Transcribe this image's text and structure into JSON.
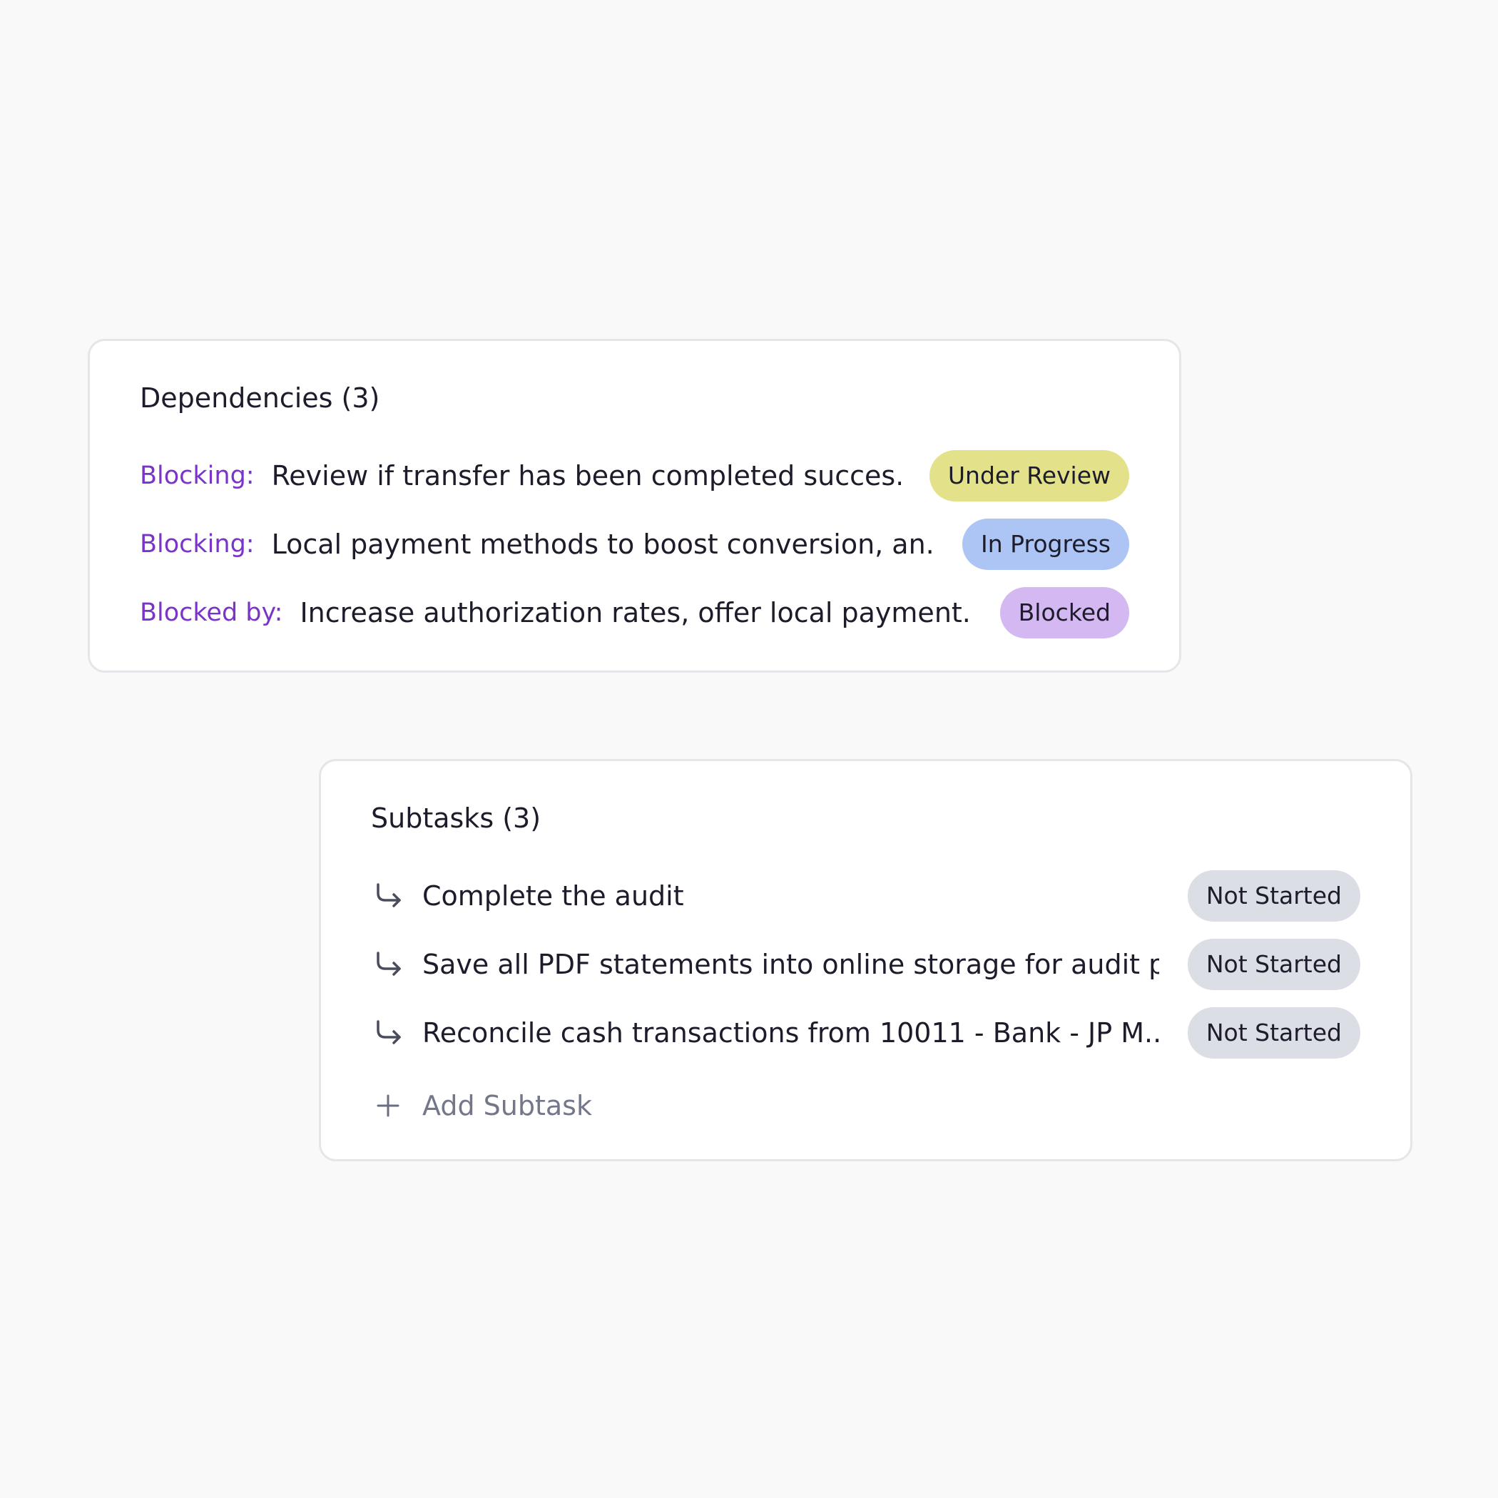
{
  "dependencies": {
    "title": "Dependencies (3)",
    "items": [
      {
        "label": "Blocking:",
        "text": "Review if transfer has been completed succes...",
        "status": "Under Review",
        "status_color": "#e3e28a"
      },
      {
        "label": "Blocking:",
        "text": "Local payment methods to boost conversion, an...",
        "status": "In Progress",
        "status_color": "#adc5f5"
      },
      {
        "label": "Blocked by:",
        "text": "Increase authorization rates, offer local payment...",
        "status": "Blocked",
        "status_color": "#d3b8f2"
      }
    ]
  },
  "subtasks": {
    "title": "Subtasks (3)",
    "items": [
      {
        "icon": "subtask-arrow-icon",
        "text": "Complete the audit",
        "status": "Not Started",
        "status_color": "#dcdee6"
      },
      {
        "icon": "subtask-arrow-icon",
        "text": "Save all PDF statements into online storage for audit p...",
        "status": "Not Started",
        "status_color": "#dcdee6"
      },
      {
        "icon": "subtask-arrow-icon",
        "text": "Reconcile cash transactions from 10011 - Bank - JP M...",
        "status": "Not Started",
        "status_color": "#dcdee6"
      }
    ],
    "add_label": "Add Subtask",
    "add_icon": "plus-icon"
  },
  "colors": {
    "background": "#f9f9fa",
    "accent_label": "#7a35c8",
    "muted_text": "#74778a"
  }
}
